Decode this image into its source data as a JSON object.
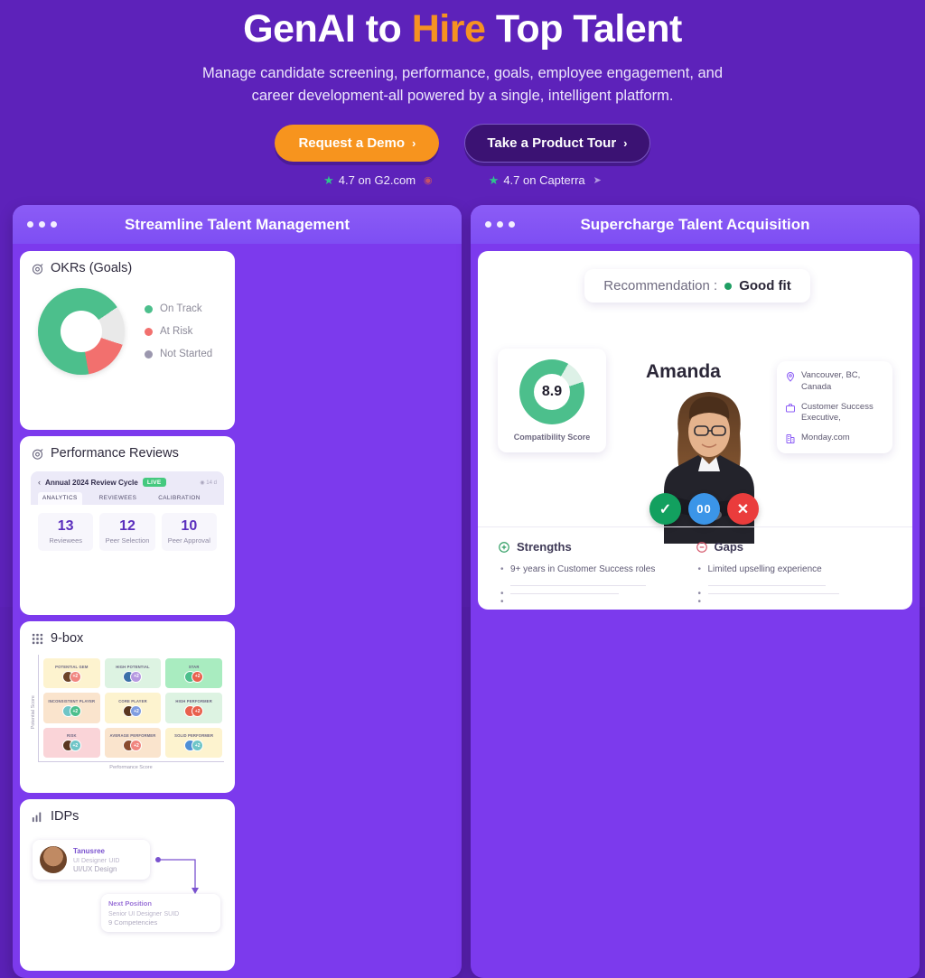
{
  "hero": {
    "title_1": "GenAI to ",
    "title_accent": "Hire",
    "title_2": " Top Talent",
    "subtitle_line1": "Manage candidate screening, performance, goals, employee engagement, and",
    "subtitle_line2": "career development-all powered by a single, intelligent platform.",
    "cta_primary": "Request a Demo",
    "cta_secondary": "Take a Product Tour",
    "chevron": "›",
    "ratings": [
      {
        "star": "★",
        "text": "4.7 on G2.com",
        "mark": "◉"
      },
      {
        "star": "★",
        "text": "4.7 on Capterra",
        "mark": "➤"
      }
    ],
    "accent_color": "#f59222",
    "bg_color": "#5d22ba"
  },
  "left_panel": {
    "title": "Streamline Talent Management",
    "okr": {
      "title": "OKRs (Goals)",
      "icon": "target-icon",
      "legend": [
        {
          "label": "On Track",
          "color": "#4cbf8c"
        },
        {
          "label": "At Risk",
          "color": "#f2706e"
        },
        {
          "label": "Not Started",
          "color": "#9b97ae"
        }
      ]
    },
    "performance": {
      "title": "Performance Reviews",
      "icon": "target-icon",
      "back_arrow": "‹",
      "cycle_name": "Annual 2024 Review Cycle",
      "live_badge": "LIVE",
      "meta": "◉ 14 d",
      "tabs": [
        "ANALYTICS",
        "REVIEWEES",
        "CALIBRATION"
      ],
      "active_tab": "ANALYTICS",
      "stats": [
        {
          "value": "13",
          "label": "Reviewees"
        },
        {
          "value": "12",
          "label": "Peer Selection"
        },
        {
          "value": "10",
          "label": "Peer Approval"
        }
      ]
    },
    "ninebox": {
      "title": "9-box",
      "icon": "grid-icon",
      "y_axis": "Potential Score",
      "x_axis": "Performance Score",
      "cells": [
        {
          "label": "POTENTIAL GEM",
          "bg": "#fdf3cf",
          "a1": "#6d4429",
          "a2": "#f0857f"
        },
        {
          "label": "HIGH POTENTIAL",
          "bg": "#ddf3e2",
          "a1": "#3b6fa8",
          "a2": "#b598e0"
        },
        {
          "label": "STAR",
          "bg": "#a9ecc0",
          "a1": "#4cbf8c",
          "a2": "#e8614d"
        },
        {
          "label": "INCONSISTENT PLAYER",
          "bg": "#fae4cd",
          "a1": "#6fc5c7",
          "a2": "#4cbf8c"
        },
        {
          "label": "CORE PLAYER",
          "bg": "#fdf3cf",
          "a1": "#5a3720",
          "a2": "#7f9de0"
        },
        {
          "label": "HIGH PERFORMER",
          "bg": "#ddf3e2",
          "a1": "#e8614d",
          "a2": "#e8614d"
        },
        {
          "label": "RISK",
          "bg": "#fad4d8",
          "a1": "#5a3720",
          "a2": "#6fc5c7"
        },
        {
          "label": "AVERAGE PERFORMER",
          "bg": "#fae4cd",
          "a1": "#8a4b2e",
          "a2": "#f0857f"
        },
        {
          "label": "SOLID PERFORMER",
          "bg": "#fdf3cf",
          "a1": "#4f8fd6",
          "a2": "#6fc5c7"
        }
      ]
    },
    "idp": {
      "title": "IDPs",
      "icon": "bar-chart-icon",
      "person_name": "Tanusree",
      "person_role": "UI Designer",
      "person_role_code": "UID",
      "person_dept": "UI/UX Design",
      "next_label": "Next Position",
      "next_role": "Senior UI Designer",
      "next_role_code": "SUID",
      "competencies": "9 Competencies"
    }
  },
  "right_panel": {
    "title": "Supercharge Talent Acquisition",
    "recommendation_label": "Recommendation :",
    "recommendation_value": "Good fit",
    "recommendation_color": "#1f9e63",
    "score_value": "8.9",
    "score_label": "Compatibility Score",
    "candidate_name": "Amanda",
    "info": [
      {
        "icon": "location-pin-icon",
        "text": "Vancouver, BC, Canada"
      },
      {
        "icon": "briefcase-icon",
        "text": "Customer Success Executive,"
      },
      {
        "icon": "building-icon",
        "text": "Monday.com"
      }
    ],
    "actions": [
      {
        "name": "approve-button",
        "glyph": "✓",
        "color": "#12a05f"
      },
      {
        "name": "hold-button",
        "glyph": "00",
        "color": "#3b95e8"
      },
      {
        "name": "reject-button",
        "glyph": "✕",
        "color": "#ea3c3c"
      }
    ],
    "strengths": {
      "title": "Strengths",
      "icon": "plus-circle-icon",
      "color": "#2f9e63",
      "items": [
        "9+ years in Customer Success roles",
        "",
        ""
      ]
    },
    "gaps": {
      "title": "Gaps",
      "icon": "minus-circle-icon",
      "color": "#d4566a",
      "items": [
        "Limited upselling experience",
        "",
        ""
      ]
    }
  }
}
